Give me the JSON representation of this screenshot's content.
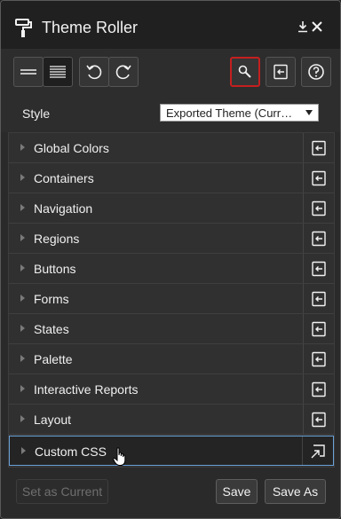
{
  "window": {
    "title": "Theme Roller",
    "app_icon": "paint-roller-icon",
    "controls": [
      "download-icon",
      "close-icon"
    ]
  },
  "toolbar": {
    "buttons": [
      {
        "name": "simple-view",
        "icon": "lines-icon"
      },
      {
        "name": "detailed-view",
        "icon": "dense-lines-icon",
        "active": true
      },
      {
        "name": "undo",
        "icon": "undo-icon"
      },
      {
        "name": "redo",
        "icon": "redo-icon"
      },
      {
        "name": "search",
        "icon": "search-icon",
        "highlighted": true
      },
      {
        "name": "reset",
        "icon": "reset-icon"
      },
      {
        "name": "help",
        "icon": "help-icon"
      }
    ]
  },
  "style": {
    "label": "Style",
    "selected": "Exported Theme (Curr…"
  },
  "groups": [
    {
      "label": "Global Colors"
    },
    {
      "label": "Containers"
    },
    {
      "label": "Navigation"
    },
    {
      "label": "Regions"
    },
    {
      "label": "Buttons"
    },
    {
      "label": "Forms"
    },
    {
      "label": "States"
    },
    {
      "label": "Palette"
    },
    {
      "label": "Interactive Reports"
    },
    {
      "label": "Layout"
    },
    {
      "label": "Custom CSS",
      "highlighted": true
    }
  ],
  "footer": {
    "set_as_current": "Set as Current",
    "save": "Save",
    "save_as": "Save As"
  },
  "colors": {
    "accent_highlight": "#c51f1f",
    "selection_border": "#6aa1d8"
  }
}
